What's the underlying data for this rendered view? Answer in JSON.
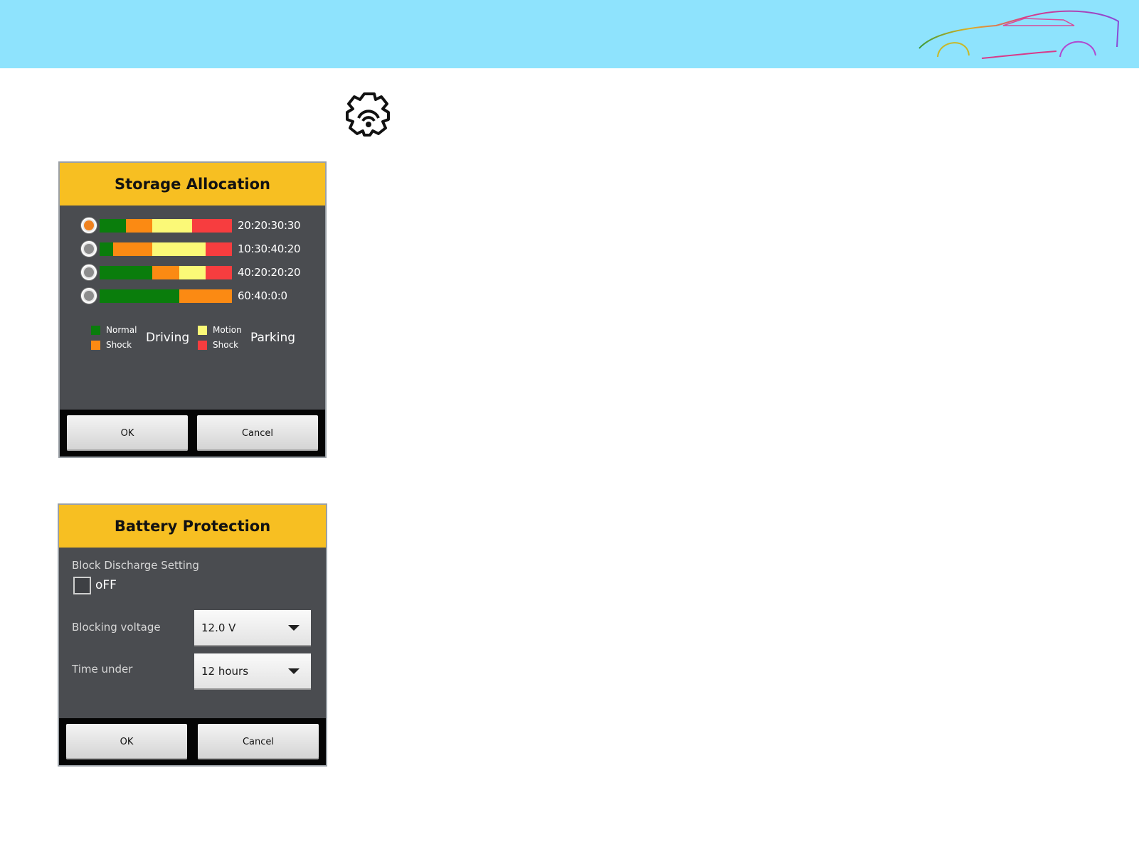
{
  "storage_dialog": {
    "title": "Storage Allocation",
    "options": [
      {
        "label": "20:20:30:30",
        "selected": true,
        "ratios": [
          20,
          20,
          30,
          30
        ]
      },
      {
        "label": "10:30:40:20",
        "selected": false,
        "ratios": [
          10,
          30,
          40,
          20
        ]
      },
      {
        "label": "40:20:20:20",
        "selected": false,
        "ratios": [
          40,
          20,
          20,
          20
        ]
      },
      {
        "label": "60:40:0:0",
        "selected": false,
        "ratios": [
          60,
          40,
          0,
          0
        ]
      }
    ],
    "legend": {
      "driving_label": "Driving",
      "parking_label": "Parking",
      "normal": "Normal",
      "driving_shock": "Shock",
      "motion": "Motion",
      "parking_shock": "Shock"
    },
    "ok_label": "OK",
    "cancel_label": "Cancel"
  },
  "battery_dialog": {
    "title": "Battery Protection",
    "block_discharge_label": "Block Discharge Setting",
    "checkbox_state": "oFF",
    "blocking_voltage_label": "Blocking voltage",
    "blocking_voltage_value": "12.0 V",
    "time_under_label": "Time under",
    "time_under_value": "12 hours",
    "ok_label": "OK",
    "cancel_label": "Cancel"
  },
  "colors": {
    "banner": "#8ee3fd",
    "header": "#f7bf22",
    "dialog_body": "#4a4c50",
    "normal": "#0a7d0c",
    "driving_shock": "#fb8a13",
    "motion": "#fbf977",
    "parking_shock": "#f73d3f",
    "radio_selected": "#f0821f"
  }
}
